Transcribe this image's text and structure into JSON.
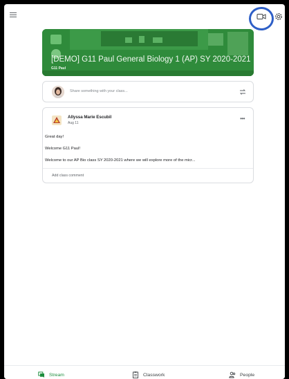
{
  "class": {
    "title": "[DEMO] G11 Paul General Biology 1 (AP) SY 2020-2021",
    "section": "G11 Paul"
  },
  "share": {
    "placeholder": "Share something with your class..."
  },
  "post": {
    "author": "Allyssa Marie Escubil",
    "date": "Aug 11",
    "lines": [
      "Great day!",
      "Welcome G11 Paul!",
      "Welcome to our AP Bio class SY 2020-2021 where we will explore more of the micr..."
    ],
    "comment_label": "Add class comment"
  },
  "nav": {
    "stream": "Stream",
    "classwork": "Classwork",
    "people": "People"
  },
  "colors": {
    "accent": "#1e8e3e",
    "banner": "#2f8b3b",
    "highlight": "#2e5fc7"
  }
}
